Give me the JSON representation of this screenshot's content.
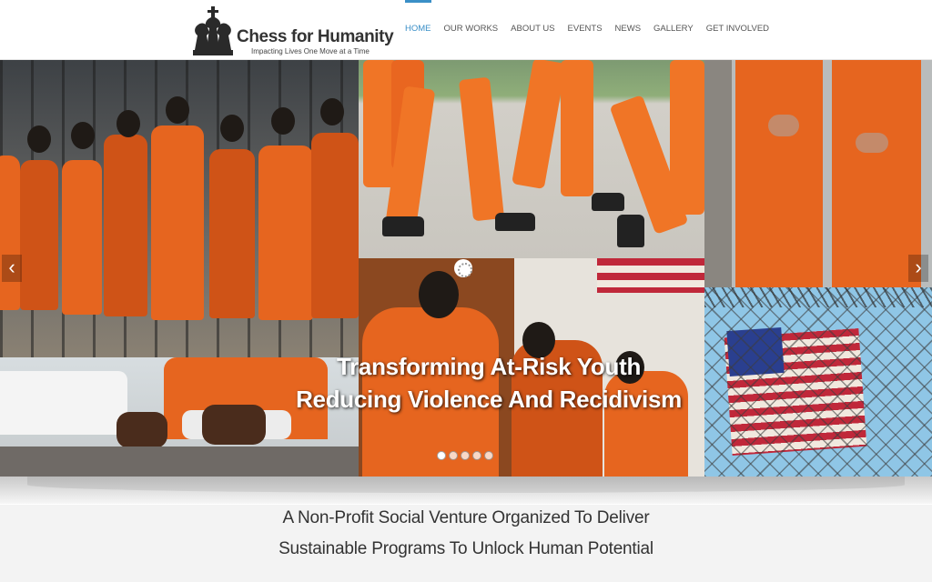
{
  "brand": {
    "title": "Chess for Humanity",
    "tagline": "Impacting Lives One Move at a Time",
    "logo_icon": "chess-pieces-icon"
  },
  "nav": {
    "items": [
      {
        "label": "HOME",
        "active": true
      },
      {
        "label": "OUR WORKS",
        "active": false
      },
      {
        "label": "ABOUT US",
        "active": false
      },
      {
        "label": "EVENTS",
        "active": false
      },
      {
        "label": "NEWS",
        "active": false
      },
      {
        "label": "GALLERY",
        "active": false
      },
      {
        "label": "GET INVOLVED",
        "active": false
      }
    ],
    "active_color": "#3a8fc7"
  },
  "slider": {
    "caption_line1": "Transforming At-Risk Youth",
    "caption_line2": "Reducing Violence And Recidivism",
    "prev_icon": "chevron-left-icon",
    "next_icon": "chevron-right-icon",
    "prev_glyph": "‹",
    "next_glyph": "›",
    "slide_count": 5,
    "active_slide": 1
  },
  "mission": {
    "line1": "A Non-Profit Social Venture Organized To Deliver",
    "line2": "Sustainable Programs To Unlock Human Potential"
  },
  "colors": {
    "accent": "#3a8fc7",
    "jumpsuit_orange": "#e6651f"
  }
}
